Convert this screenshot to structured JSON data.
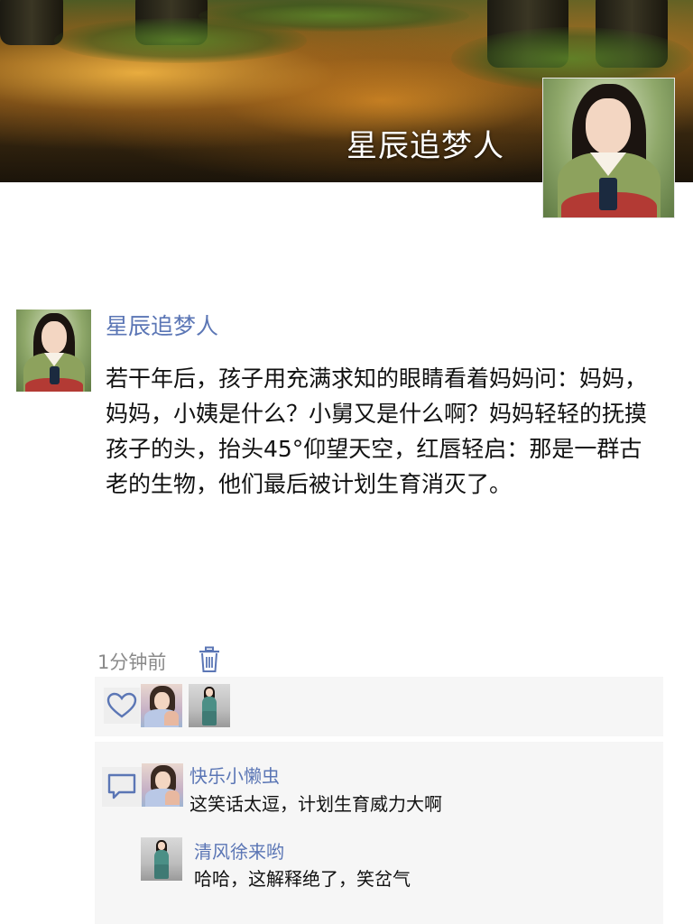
{
  "profile": {
    "cover_name": "星辰追梦人",
    "avatar_icon": "woman-hanbok-portrait"
  },
  "post": {
    "author": "星辰追梦人",
    "text": "若干年后，孩子用充满求知的眼睛看着妈妈问：妈妈，妈妈，小姨是什么？小舅又是什么啊？妈妈轻轻的抚摸孩子的头，抬头45°仰望天空，红唇轻启：那是一群古老的生物，他们最后被计划生育消灭了。",
    "time": "1分钟前",
    "delete_icon": "trash-icon"
  },
  "likes": {
    "icon": "heart-icon",
    "avatars": [
      "user-avatar-1",
      "user-avatar-2"
    ]
  },
  "comments": {
    "icon": "comment-bubble-icon",
    "items": [
      {
        "user": "快乐小懒虫",
        "text": "这笑话太逗，计划生育威力大啊"
      },
      {
        "user": "清风徐来哟",
        "text": "哈哈，这解释绝了，笑岔气"
      }
    ]
  },
  "colors": {
    "link_blue": "#5b76b5",
    "time_gray": "#8a8a8a",
    "panel_bg": "#f6f6f6"
  }
}
